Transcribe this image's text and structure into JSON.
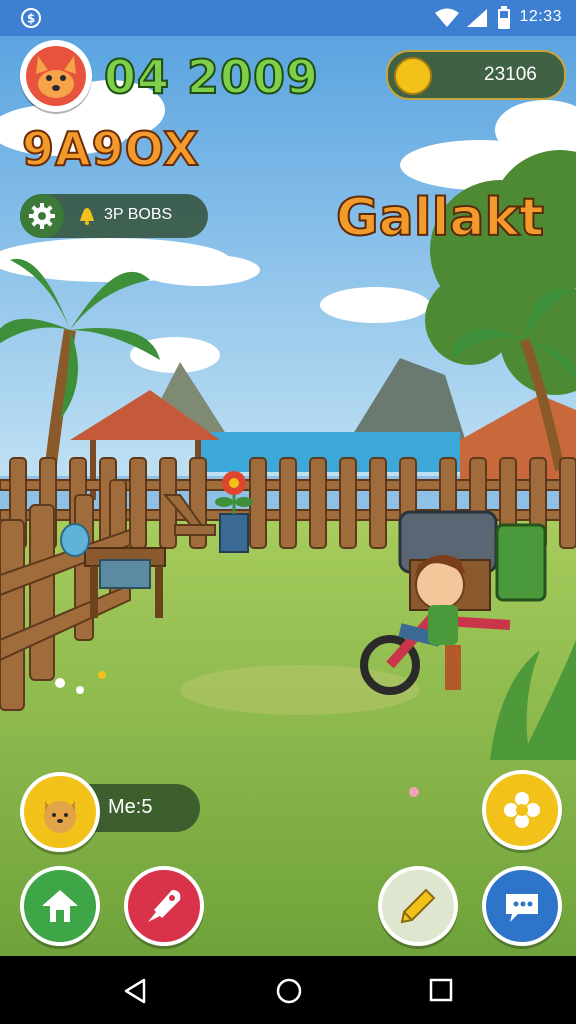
{
  "status_bar": {
    "time": "12:33"
  },
  "hud": {
    "score": "04 2009",
    "player_name": "9A9OX",
    "level_chip_text": "3P BOBS",
    "coins": "23106",
    "location_title": "Gallakt",
    "pet_level": "Me:5"
  },
  "icons": {
    "status": [
      "coin-status-icon",
      "wifi-icon",
      "signal-icon",
      "battery-icon"
    ],
    "buttons": [
      "gear-icon",
      "flower-icon",
      "home-icon",
      "rocket-icon",
      "pencil-icon",
      "chat-icon"
    ]
  },
  "colors": {
    "status_bar": "#3d7fd1",
    "grass": "#86b84b",
    "fence": "#9c6b3c",
    "sky": "#8fc1e8",
    "accent_yellow": "#f3c21a",
    "accent_green": "#3fa648",
    "accent_red": "#d8334a",
    "accent_blue": "#2e74c9"
  }
}
